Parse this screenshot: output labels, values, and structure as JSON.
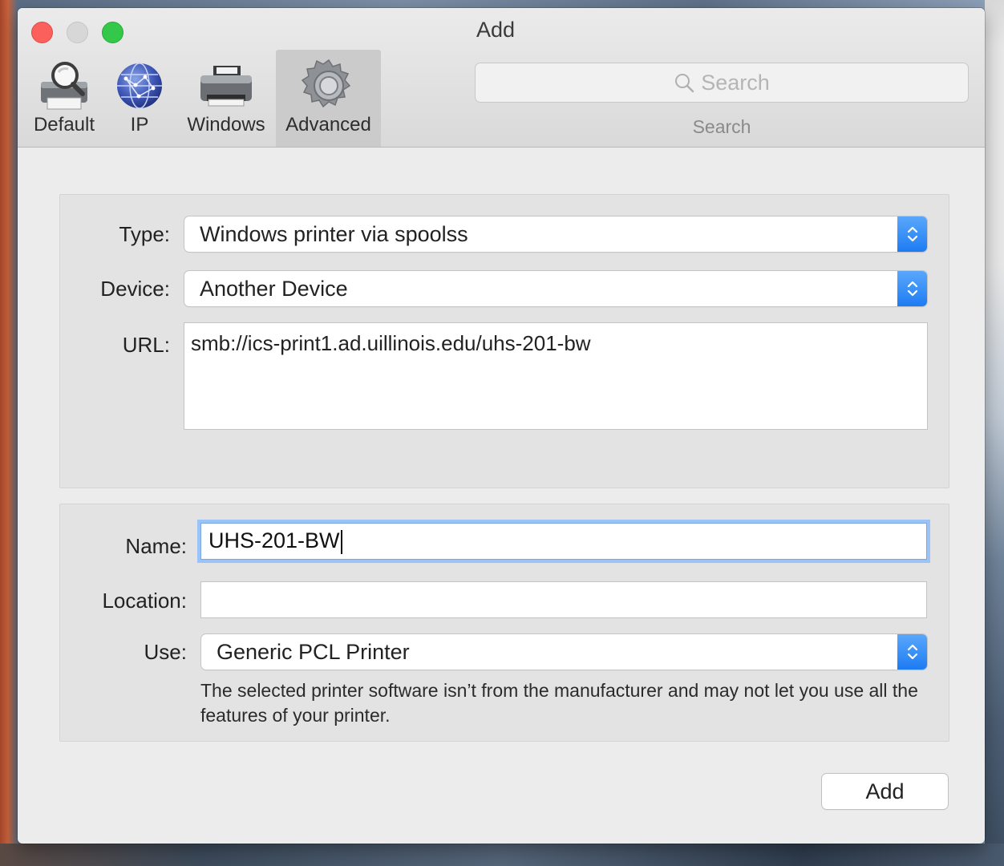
{
  "window": {
    "title": "Add"
  },
  "toolbar": {
    "tabs": [
      {
        "label": "Default",
        "icon": "printer-magnifier-icon"
      },
      {
        "label": "IP",
        "icon": "globe-icon"
      },
      {
        "label": "Windows",
        "icon": "printer-icon"
      },
      {
        "label": "Advanced",
        "icon": "gear-icon",
        "selected": true
      }
    ],
    "search": {
      "placeholder": "Search",
      "caption": "Search"
    }
  },
  "form": {
    "type": {
      "label": "Type:",
      "value": "Windows printer via spoolss"
    },
    "device": {
      "label": "Device:",
      "value": "Another Device"
    },
    "url": {
      "label": "URL:",
      "value": "smb://ics-print1.ad.uillinois.edu/uhs-201-bw"
    },
    "name": {
      "label": "Name:",
      "value": "UHS-201-BW"
    },
    "location": {
      "label": "Location:",
      "value": ""
    },
    "use": {
      "label": "Use:",
      "value": "Generic PCL Printer"
    },
    "note": "The selected printer software isn’t from the manufacturer and may not let you use all the features of your printer."
  },
  "footer": {
    "add_label": "Add"
  },
  "colors": {
    "accent": "#1d7bf2",
    "focus_ring": "#9cc3f7",
    "close": "#fc605c",
    "zoom": "#34c84a"
  }
}
